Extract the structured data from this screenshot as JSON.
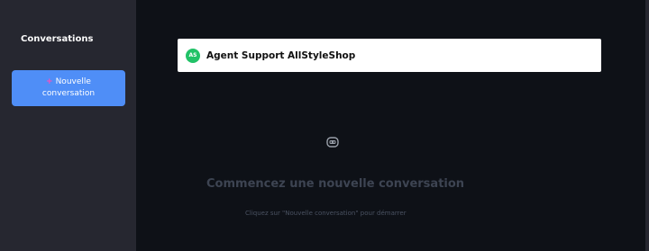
{
  "sidebar": {
    "title": "Conversations",
    "new_button": {
      "icon": "plus-icon",
      "line1": "Nouvelle",
      "line2": "conversation"
    }
  },
  "header": {
    "avatar_initials": "AS",
    "agent_name": "Agent Support AllStyleShop"
  },
  "empty_state": {
    "icon": "robot-icon",
    "title": "Commencez une nouvelle conversation",
    "hint": "Cliquez sur \"Nouvelle conversation\" pour démarrer"
  },
  "colors": {
    "background": "#0e1117",
    "sidebar": "#262730",
    "accent": "#4f8ef7",
    "avatar": "#21c267"
  }
}
